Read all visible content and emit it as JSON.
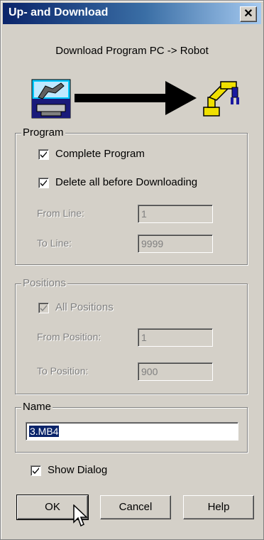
{
  "window": {
    "title": "Up- and Download",
    "close_glyph": "✕"
  },
  "header": {
    "subtitle": "Download Program PC -> Robot"
  },
  "icons": {
    "source": "pc-icon",
    "direction": "right-arrow-icon",
    "target": "robot-icon"
  },
  "program": {
    "legend": "Program",
    "complete_program": {
      "label": "Complete Program",
      "checked": true
    },
    "delete_before": {
      "label": "Delete all before Downloading",
      "checked": true
    },
    "from_line": {
      "label": "From Line:",
      "value": "1"
    },
    "to_line": {
      "label": "To Line:",
      "value": "9999"
    }
  },
  "positions": {
    "legend": "Positions",
    "all_positions": {
      "label": "All Positions",
      "checked": true
    },
    "from_position": {
      "label": "From Position:",
      "value": "1"
    },
    "to_position": {
      "label": "To Position:",
      "value": "900"
    }
  },
  "name": {
    "legend": "Name",
    "value": "3.MB4"
  },
  "show_dialog": {
    "label": "Show Dialog",
    "checked": true
  },
  "buttons": {
    "ok": "OK",
    "cancel": "Cancel",
    "help": "Help"
  },
  "colors": {
    "titlebar_start": "#0a246a",
    "titlebar_end": "#a6caf0",
    "face": "#d4d0c8",
    "selection": "#0a246a"
  }
}
